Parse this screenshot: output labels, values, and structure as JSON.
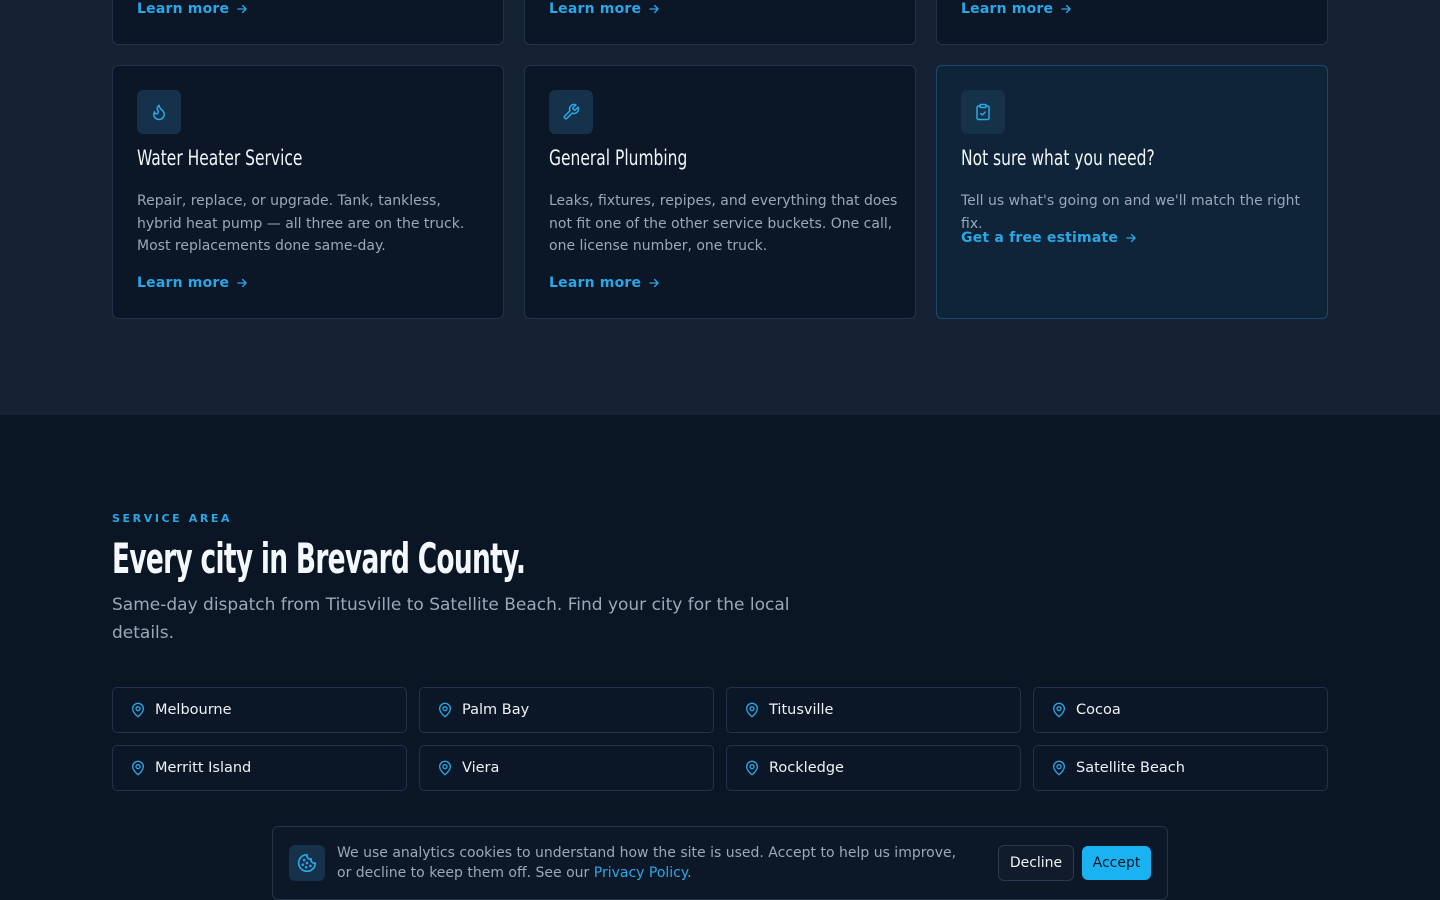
{
  "services": {
    "top_row_links": [
      "Learn more",
      "Learn more",
      "Learn more"
    ],
    "cards": [
      {
        "title": "Water Heater Service",
        "description": "Repair, replace, or upgrade. Tank, tankless, hybrid heat pump — all three are on the truck. Most replacements done same-day.",
        "link": "Learn more",
        "icon": "flame-icon"
      },
      {
        "title": "General Plumbing",
        "description": "Leaks, fixtures, repipes, and everything that does not fit one of the other service buckets. One call, one license number, one truck.",
        "link": "Learn more",
        "icon": "wrench-icon"
      },
      {
        "title": "Not sure what you need?",
        "description": "Tell us what's going on and we'll match the right fix.",
        "link": "Get a free estimate",
        "icon": "clipboard-check-icon"
      }
    ]
  },
  "service_area": {
    "label": "SERVICE AREA",
    "title": "Every city in Brevard County.",
    "subtitle": "Same-day dispatch from Titusville to Satellite Beach. Find your city for the local details.",
    "cities": [
      "Melbourne",
      "Palm Bay",
      "Titusville",
      "Cocoa",
      "Merritt Island",
      "Viera",
      "Rockledge",
      "Satellite Beach"
    ]
  },
  "cookie_banner": {
    "text_before": "We use analytics cookies to understand how the site is used. Accept to help us improve, or decline to keep them off. See our ",
    "link_text": "Privacy Policy",
    "text_after": ".",
    "decline_label": "Decline",
    "accept_label": "Accept",
    "icon": "cookie-icon"
  },
  "colors": {
    "accent": "#2aa7e6",
    "accept_button": "#19b3f2",
    "background": "#0a1624",
    "card": "#0b1626"
  }
}
